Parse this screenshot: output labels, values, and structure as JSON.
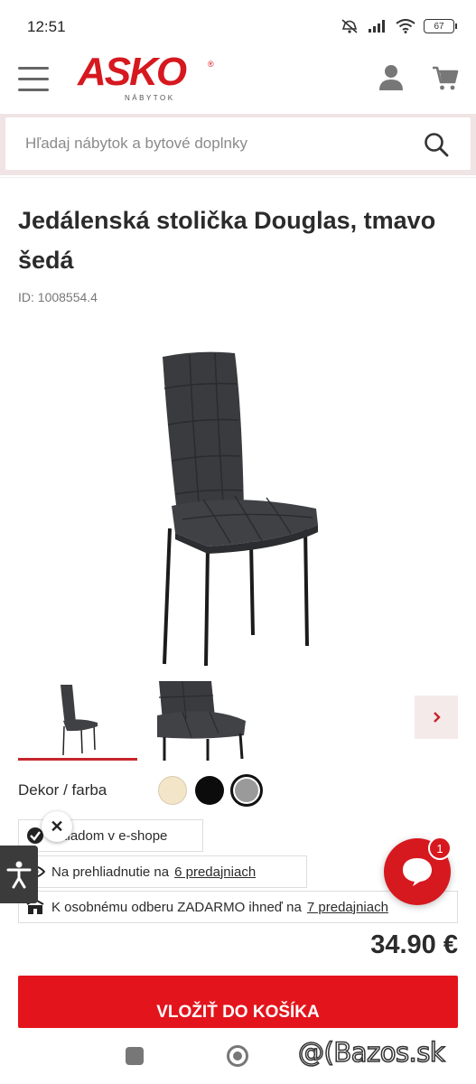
{
  "status_bar": {
    "time": "12:51",
    "battery": "67"
  },
  "header": {
    "logo_text": "ASKO",
    "logo_sub": "NÁBYTOK",
    "logo_reg": "®"
  },
  "search": {
    "placeholder": "Hľadaj nábytok a bytové doplnky"
  },
  "product": {
    "title": "Jedálenská stolička Douglas, tmavo šedá",
    "id_label": "ID: 1008554.4"
  },
  "decor": {
    "label": "Dekor / farba",
    "swatches": [
      {
        "name": "beige",
        "color": "#f3e6c8"
      },
      {
        "name": "black",
        "color": "#0c0c0c"
      },
      {
        "name": "grey",
        "color": "#9a9a9a",
        "selected": true
      }
    ]
  },
  "availability": {
    "stock": "Skladom v e-shope",
    "showroom_text": "Na prehliadnutie na",
    "showroom_link": "6 predajniach",
    "pickup_text": "K osobnému odberu ZADARMO ihneď na",
    "pickup_link": "7 predajniach"
  },
  "chat": {
    "badge": "1"
  },
  "price": "34.90 €",
  "cta": {
    "label": "VLOŽIŤ DO KOŠÍKA"
  },
  "watermark": "@(Bazos.sk",
  "colors": {
    "brand_red": "#d6181f",
    "cta_red": "#e3141c"
  }
}
